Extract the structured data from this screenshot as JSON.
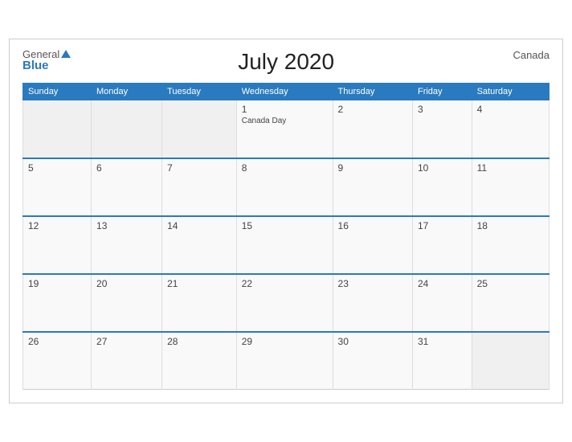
{
  "header": {
    "logo_general": "General",
    "logo_blue": "Blue",
    "title": "July 2020",
    "country": "Canada"
  },
  "weekdays": [
    "Sunday",
    "Monday",
    "Tuesday",
    "Wednesday",
    "Thursday",
    "Friday",
    "Saturday"
  ],
  "weeks": [
    [
      {
        "day": "",
        "empty": true
      },
      {
        "day": "",
        "empty": true
      },
      {
        "day": "",
        "empty": true
      },
      {
        "day": "1",
        "event": "Canada Day"
      },
      {
        "day": "2"
      },
      {
        "day": "3"
      },
      {
        "day": "4"
      }
    ],
    [
      {
        "day": "5"
      },
      {
        "day": "6"
      },
      {
        "day": "7"
      },
      {
        "day": "8"
      },
      {
        "day": "9"
      },
      {
        "day": "10"
      },
      {
        "day": "11"
      }
    ],
    [
      {
        "day": "12"
      },
      {
        "day": "13"
      },
      {
        "day": "14"
      },
      {
        "day": "15"
      },
      {
        "day": "16"
      },
      {
        "day": "17"
      },
      {
        "day": "18"
      }
    ],
    [
      {
        "day": "19"
      },
      {
        "day": "20"
      },
      {
        "day": "21"
      },
      {
        "day": "22"
      },
      {
        "day": "23"
      },
      {
        "day": "24"
      },
      {
        "day": "25"
      }
    ],
    [
      {
        "day": "26"
      },
      {
        "day": "27"
      },
      {
        "day": "28"
      },
      {
        "day": "29"
      },
      {
        "day": "30"
      },
      {
        "day": "31"
      },
      {
        "day": "",
        "empty": true
      }
    ]
  ]
}
